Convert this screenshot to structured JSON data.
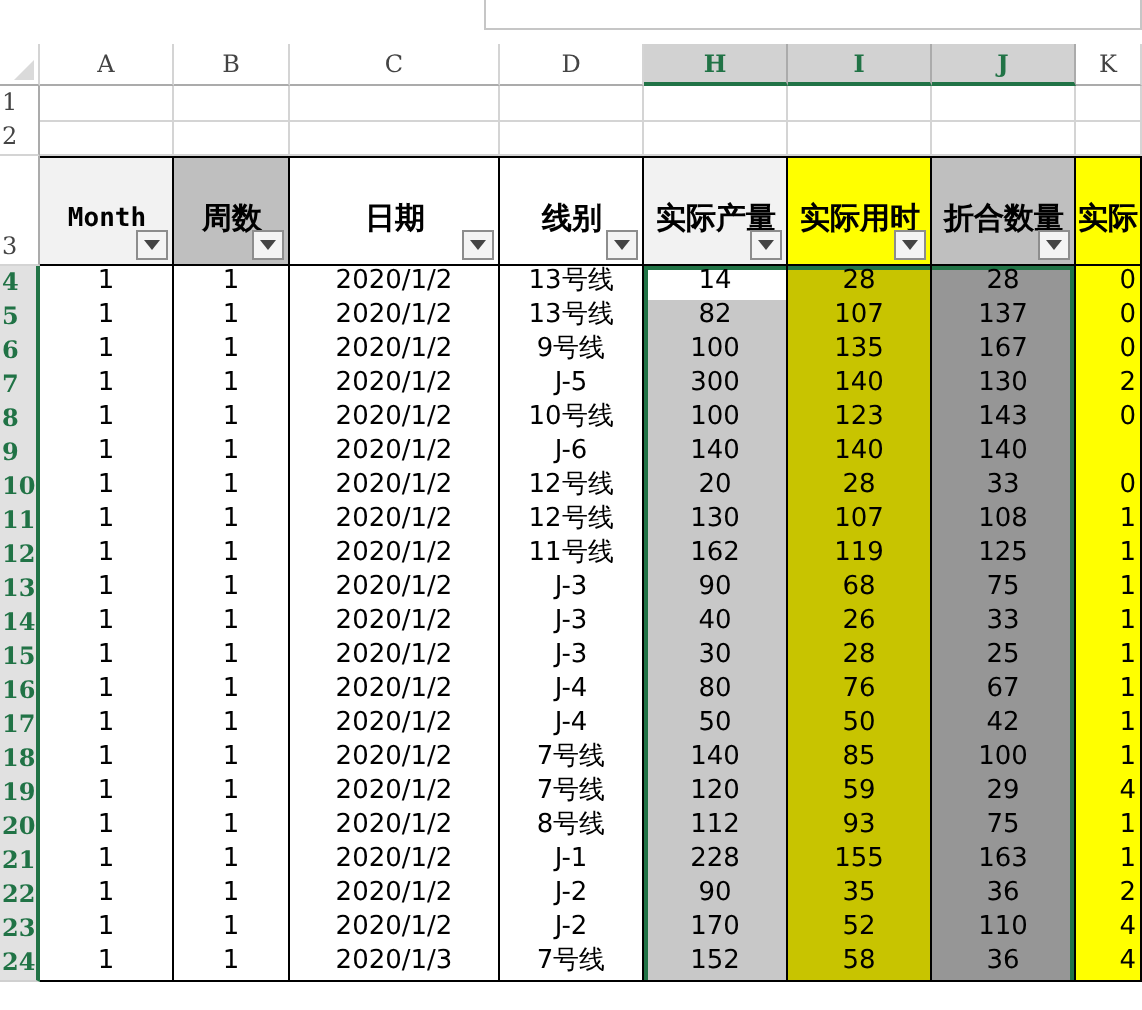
{
  "formula_bar": {
    "kind": "field"
  },
  "columns": [
    {
      "letter": "A",
      "selected": false,
      "header": "Month",
      "color": "#f2f2f2",
      "body": {
        "color": "#ffffff"
      },
      "filter": true
    },
    {
      "letter": "B",
      "selected": false,
      "header": "周数",
      "color": "#bfbfbf",
      "body": {
        "color": "#ffffff"
      },
      "filter": true
    },
    {
      "letter": "C",
      "selected": false,
      "header": "日期",
      "color": "#ffffff",
      "body": {
        "color": "#ffffff"
      },
      "filter": true
    },
    {
      "letter": "D",
      "selected": false,
      "header": "线别",
      "color": "#ffffff",
      "body": {
        "color": "#ffffff"
      },
      "filter": true
    },
    {
      "letter": "H",
      "selected": true,
      "active": true,
      "header": "实际产量",
      "color": "#f2f2f2",
      "body": {
        "color": "#c8c8c8"
      },
      "filter": true
    },
    {
      "letter": "I",
      "selected": true,
      "header": "实际用时",
      "color": "#ffff00",
      "body": {
        "color": "#c8c400"
      },
      "filter": true
    },
    {
      "letter": "J",
      "selected": true,
      "header": "折合数量",
      "color": "#bfbfbf",
      "body": {
        "color": "#969696"
      },
      "filter": true
    },
    {
      "letter": "K",
      "selected": false,
      "header": "实际",
      "color": "#ffff00",
      "body": {
        "color": "#ffff00"
      },
      "filter": false
    }
  ],
  "header_row": "3",
  "empty_rows": [
    "1",
    "2"
  ],
  "rows": [
    {
      "number": "4",
      "selected": true,
      "active": true,
      "cells": [
        "1",
        "1",
        "2020/1/2",
        "13号线",
        "14",
        "28",
        "28",
        "0"
      ]
    },
    {
      "number": "5",
      "selected": true,
      "cells": [
        "1",
        "1",
        "2020/1/2",
        "13号线",
        "82",
        "107",
        "137",
        "0"
      ]
    },
    {
      "number": "6",
      "selected": true,
      "cells": [
        "1",
        "1",
        "2020/1/2",
        "9号线",
        "100",
        "135",
        "167",
        "0"
      ]
    },
    {
      "number": "7",
      "selected": true,
      "cells": [
        "1",
        "1",
        "2020/1/2",
        "J-5",
        "300",
        "140",
        "130",
        "2"
      ]
    },
    {
      "number": "8",
      "selected": true,
      "cells": [
        "1",
        "1",
        "2020/1/2",
        "10号线",
        "100",
        "123",
        "143",
        "0"
      ]
    },
    {
      "number": "9",
      "selected": true,
      "cells": [
        "1",
        "1",
        "2020/1/2",
        "J-6",
        "140",
        "140",
        "140",
        null
      ]
    },
    {
      "number": "10",
      "selected": true,
      "cells": [
        "1",
        "1",
        "2020/1/2",
        "12号线",
        "20",
        "28",
        "33",
        "0"
      ]
    },
    {
      "number": "11",
      "selected": true,
      "cells": [
        "1",
        "1",
        "2020/1/2",
        "12号线",
        "130",
        "107",
        "108",
        "1"
      ]
    },
    {
      "number": "12",
      "selected": true,
      "cells": [
        "1",
        "1",
        "2020/1/2",
        "11号线",
        "162",
        "119",
        "125",
        "1"
      ]
    },
    {
      "number": "13",
      "selected": true,
      "cells": [
        "1",
        "1",
        "2020/1/2",
        "J-3",
        "90",
        "68",
        "75",
        "1"
      ]
    },
    {
      "number": "14",
      "selected": true,
      "cells": [
        "1",
        "1",
        "2020/1/2",
        "J-3",
        "40",
        "26",
        "33",
        "1"
      ]
    },
    {
      "number": "15",
      "selected": true,
      "cells": [
        "1",
        "1",
        "2020/1/2",
        "J-3",
        "30",
        "28",
        "25",
        "1"
      ]
    },
    {
      "number": "16",
      "selected": true,
      "cells": [
        "1",
        "1",
        "2020/1/2",
        "J-4",
        "80",
        "76",
        "67",
        "1"
      ]
    },
    {
      "number": "17",
      "selected": true,
      "cells": [
        "1",
        "1",
        "2020/1/2",
        "J-4",
        "50",
        "50",
        "42",
        "1"
      ]
    },
    {
      "number": "18",
      "selected": true,
      "cells": [
        "1",
        "1",
        "2020/1/2",
        "7号线",
        "140",
        "85",
        "100",
        "1"
      ]
    },
    {
      "number": "19",
      "selected": true,
      "cells": [
        "1",
        "1",
        "2020/1/2",
        "7号线",
        "120",
        "59",
        "29",
        "4"
      ]
    },
    {
      "number": "20",
      "selected": true,
      "cells": [
        "1",
        "1",
        "2020/1/2",
        "8号线",
        "112",
        "93",
        "75",
        "1"
      ]
    },
    {
      "number": "21",
      "selected": true,
      "cells": [
        "1",
        "1",
        "2020/1/2",
        "J-1",
        "228",
        "155",
        "163",
        "1"
      ]
    },
    {
      "number": "22",
      "selected": true,
      "cells": [
        "1",
        "1",
        "2020/1/2",
        "J-2",
        "90",
        "35",
        "36",
        "2"
      ]
    },
    {
      "number": "23",
      "selected": true,
      "cells": [
        "1",
        "1",
        "2020/1/2",
        "J-2",
        "170",
        "52",
        "110",
        "4"
      ]
    },
    {
      "number": "24",
      "selected": true,
      "cells": [
        "1",
        "1",
        "2020/1/3",
        "7号线",
        "152",
        "58",
        "36",
        "4"
      ]
    }
  ]
}
